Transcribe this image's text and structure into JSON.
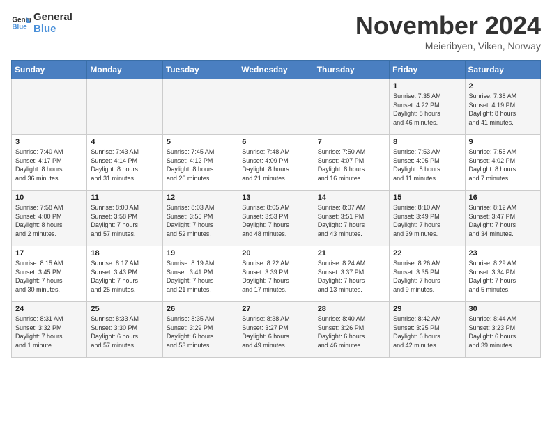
{
  "header": {
    "logo_line1": "General",
    "logo_line2": "Blue",
    "month_title": "November 2024",
    "location": "Meieribyen, Viken, Norway"
  },
  "weekdays": [
    "Sunday",
    "Monday",
    "Tuesday",
    "Wednesday",
    "Thursday",
    "Friday",
    "Saturday"
  ],
  "weeks": [
    [
      {
        "day": "",
        "info": ""
      },
      {
        "day": "",
        "info": ""
      },
      {
        "day": "",
        "info": ""
      },
      {
        "day": "",
        "info": ""
      },
      {
        "day": "",
        "info": ""
      },
      {
        "day": "1",
        "info": "Sunrise: 7:35 AM\nSunset: 4:22 PM\nDaylight: 8 hours\nand 46 minutes."
      },
      {
        "day": "2",
        "info": "Sunrise: 7:38 AM\nSunset: 4:19 PM\nDaylight: 8 hours\nand 41 minutes."
      }
    ],
    [
      {
        "day": "3",
        "info": "Sunrise: 7:40 AM\nSunset: 4:17 PM\nDaylight: 8 hours\nand 36 minutes."
      },
      {
        "day": "4",
        "info": "Sunrise: 7:43 AM\nSunset: 4:14 PM\nDaylight: 8 hours\nand 31 minutes."
      },
      {
        "day": "5",
        "info": "Sunrise: 7:45 AM\nSunset: 4:12 PM\nDaylight: 8 hours\nand 26 minutes."
      },
      {
        "day": "6",
        "info": "Sunrise: 7:48 AM\nSunset: 4:09 PM\nDaylight: 8 hours\nand 21 minutes."
      },
      {
        "day": "7",
        "info": "Sunrise: 7:50 AM\nSunset: 4:07 PM\nDaylight: 8 hours\nand 16 minutes."
      },
      {
        "day": "8",
        "info": "Sunrise: 7:53 AM\nSunset: 4:05 PM\nDaylight: 8 hours\nand 11 minutes."
      },
      {
        "day": "9",
        "info": "Sunrise: 7:55 AM\nSunset: 4:02 PM\nDaylight: 8 hours\nand 7 minutes."
      }
    ],
    [
      {
        "day": "10",
        "info": "Sunrise: 7:58 AM\nSunset: 4:00 PM\nDaylight: 8 hours\nand 2 minutes."
      },
      {
        "day": "11",
        "info": "Sunrise: 8:00 AM\nSunset: 3:58 PM\nDaylight: 7 hours\nand 57 minutes."
      },
      {
        "day": "12",
        "info": "Sunrise: 8:03 AM\nSunset: 3:55 PM\nDaylight: 7 hours\nand 52 minutes."
      },
      {
        "day": "13",
        "info": "Sunrise: 8:05 AM\nSunset: 3:53 PM\nDaylight: 7 hours\nand 48 minutes."
      },
      {
        "day": "14",
        "info": "Sunrise: 8:07 AM\nSunset: 3:51 PM\nDaylight: 7 hours\nand 43 minutes."
      },
      {
        "day": "15",
        "info": "Sunrise: 8:10 AM\nSunset: 3:49 PM\nDaylight: 7 hours\nand 39 minutes."
      },
      {
        "day": "16",
        "info": "Sunrise: 8:12 AM\nSunset: 3:47 PM\nDaylight: 7 hours\nand 34 minutes."
      }
    ],
    [
      {
        "day": "17",
        "info": "Sunrise: 8:15 AM\nSunset: 3:45 PM\nDaylight: 7 hours\nand 30 minutes."
      },
      {
        "day": "18",
        "info": "Sunrise: 8:17 AM\nSunset: 3:43 PM\nDaylight: 7 hours\nand 25 minutes."
      },
      {
        "day": "19",
        "info": "Sunrise: 8:19 AM\nSunset: 3:41 PM\nDaylight: 7 hours\nand 21 minutes."
      },
      {
        "day": "20",
        "info": "Sunrise: 8:22 AM\nSunset: 3:39 PM\nDaylight: 7 hours\nand 17 minutes."
      },
      {
        "day": "21",
        "info": "Sunrise: 8:24 AM\nSunset: 3:37 PM\nDaylight: 7 hours\nand 13 minutes."
      },
      {
        "day": "22",
        "info": "Sunrise: 8:26 AM\nSunset: 3:35 PM\nDaylight: 7 hours\nand 9 minutes."
      },
      {
        "day": "23",
        "info": "Sunrise: 8:29 AM\nSunset: 3:34 PM\nDaylight: 7 hours\nand 5 minutes."
      }
    ],
    [
      {
        "day": "24",
        "info": "Sunrise: 8:31 AM\nSunset: 3:32 PM\nDaylight: 7 hours\nand 1 minute."
      },
      {
        "day": "25",
        "info": "Sunrise: 8:33 AM\nSunset: 3:30 PM\nDaylight: 6 hours\nand 57 minutes."
      },
      {
        "day": "26",
        "info": "Sunrise: 8:35 AM\nSunset: 3:29 PM\nDaylight: 6 hours\nand 53 minutes."
      },
      {
        "day": "27",
        "info": "Sunrise: 8:38 AM\nSunset: 3:27 PM\nDaylight: 6 hours\nand 49 minutes."
      },
      {
        "day": "28",
        "info": "Sunrise: 8:40 AM\nSunset: 3:26 PM\nDaylight: 6 hours\nand 46 minutes."
      },
      {
        "day": "29",
        "info": "Sunrise: 8:42 AM\nSunset: 3:25 PM\nDaylight: 6 hours\nand 42 minutes."
      },
      {
        "day": "30",
        "info": "Sunrise: 8:44 AM\nSunset: 3:23 PM\nDaylight: 6 hours\nand 39 minutes."
      }
    ]
  ]
}
